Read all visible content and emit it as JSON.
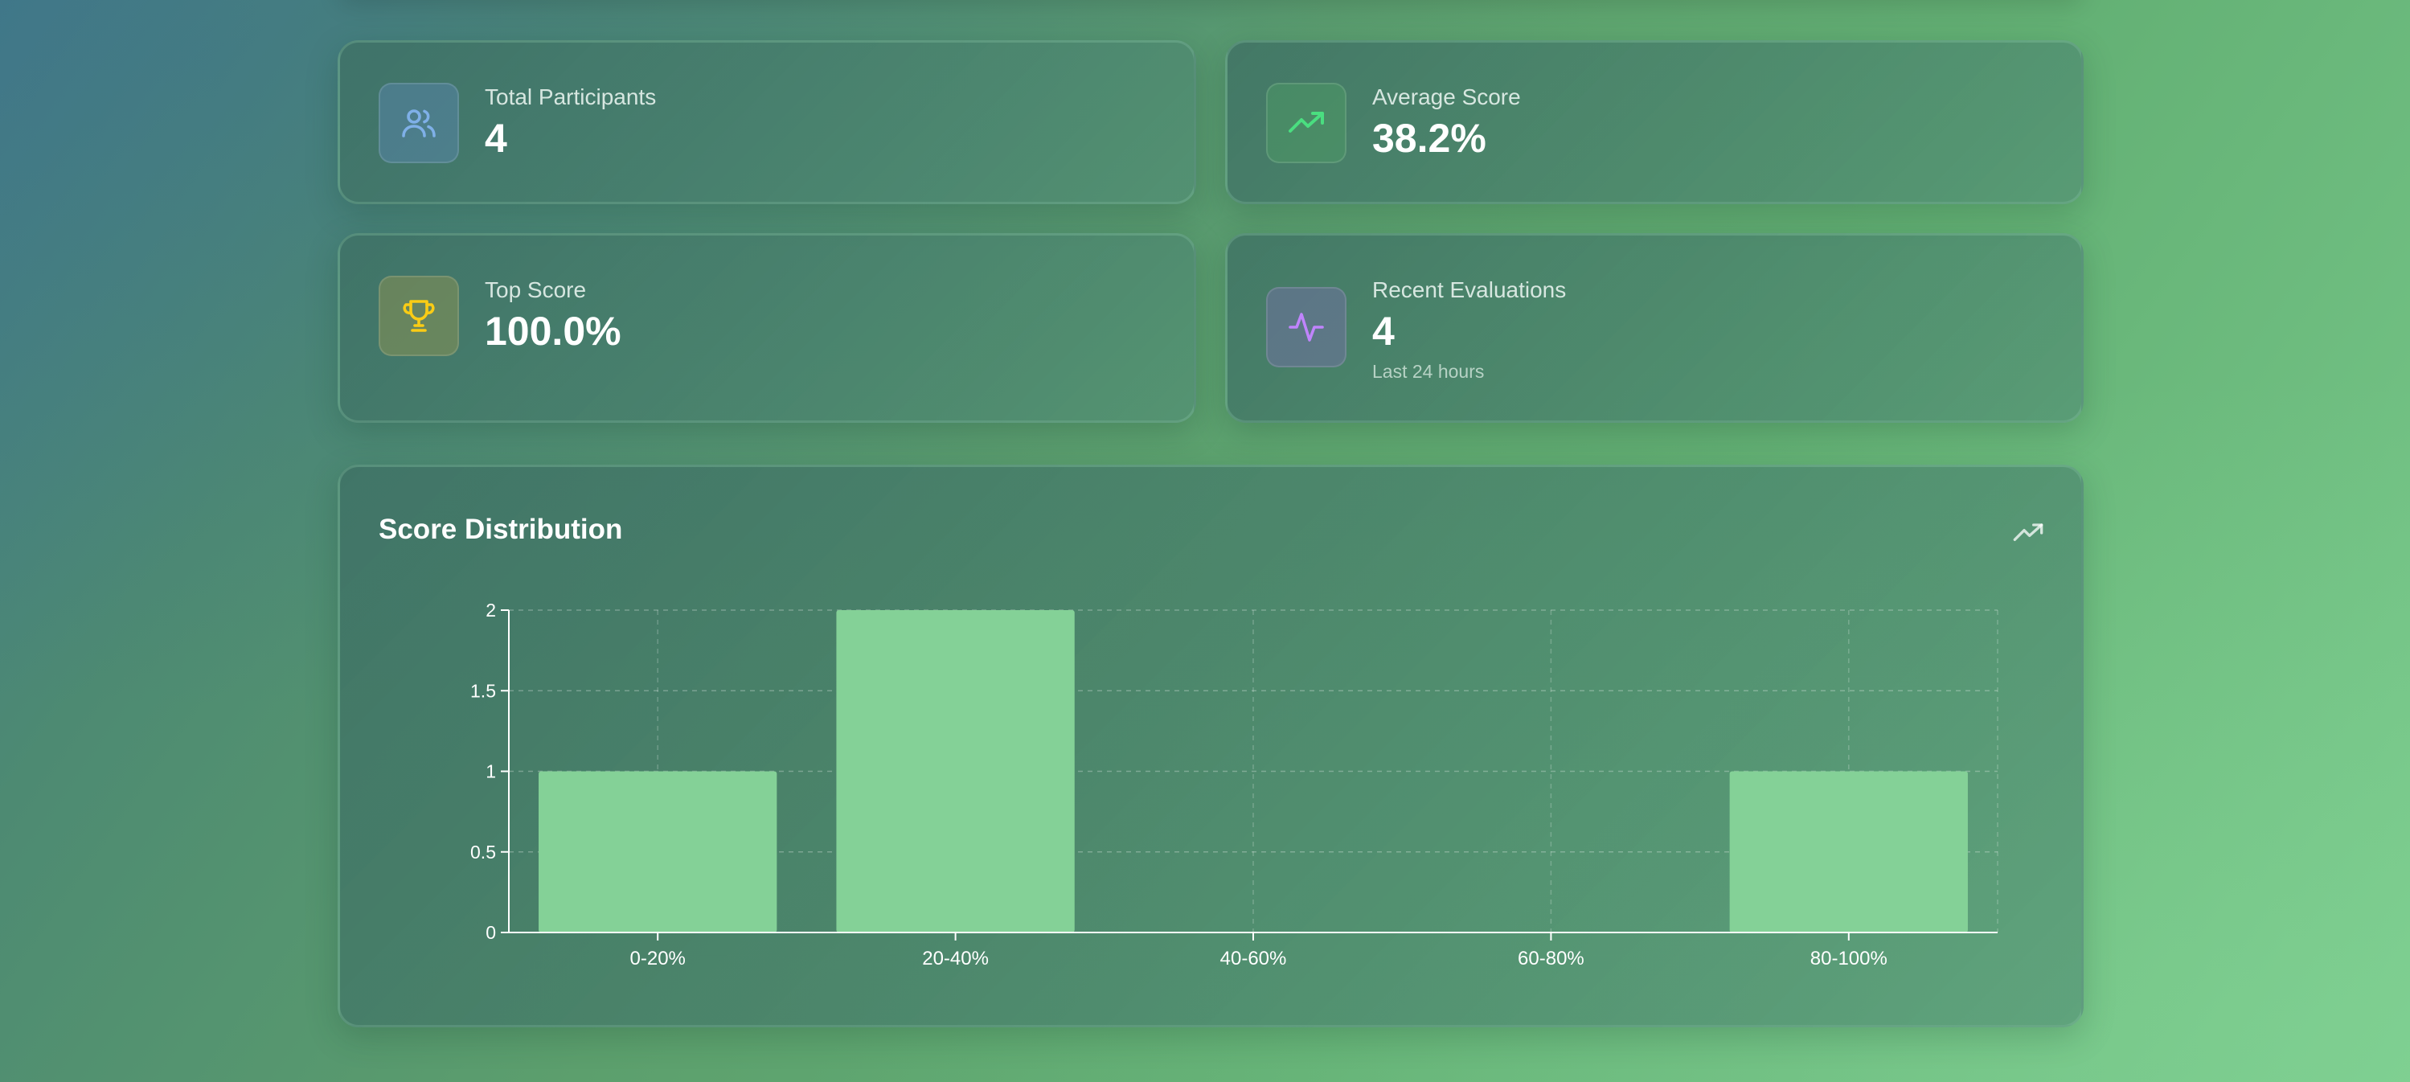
{
  "stats": [
    {
      "label": "Total Participants",
      "value": "4",
      "icon": "users-icon",
      "color": "#7fb0e8"
    },
    {
      "label": "Average Score",
      "value": "38.2%",
      "icon": "trending-up-icon",
      "color": "#4ade80"
    },
    {
      "label": "Top Score",
      "value": "100.0%",
      "icon": "trophy-icon",
      "color": "#facc15"
    },
    {
      "label": "Recent Evaluations",
      "value": "4",
      "sub": "Last 24 hours",
      "icon": "activity-icon",
      "color": "#c084fc"
    }
  ],
  "chart": {
    "title": "Score Distribution",
    "corner_icon": "trending-up-icon"
  },
  "chart_data": {
    "type": "bar",
    "title": "Score Distribution",
    "categories": [
      "0-20%",
      "20-40%",
      "40-60%",
      "60-80%",
      "80-100%"
    ],
    "values": [
      1,
      2,
      0,
      0,
      1
    ],
    "ylim": [
      0,
      2
    ],
    "yticks": [
      0,
      0.5,
      1,
      1.5,
      2
    ],
    "ytick_labels": [
      "0",
      "0.5",
      "1",
      "1.5",
      "2"
    ],
    "xlabel": "",
    "ylabel": "",
    "grid": true,
    "bar_color": "#84d197"
  }
}
